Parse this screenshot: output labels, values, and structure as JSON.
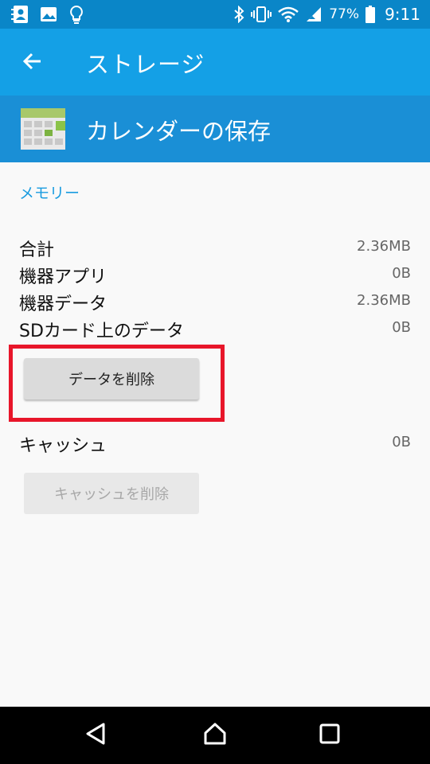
{
  "status_bar": {
    "battery": "77%",
    "time": "9:11",
    "left_icons": [
      "contact-card-icon",
      "image-icon",
      "lightbulb-icon"
    ],
    "right_icons": [
      "bluetooth-icon",
      "vibrate-icon",
      "wifi-icon",
      "signal-icon",
      "battery-icon"
    ]
  },
  "app_bar": {
    "title": "ストレージ",
    "back_icon": "back-arrow-icon"
  },
  "app_header": {
    "name": "カレンダーの保存",
    "icon": "calendar-storage-app-icon"
  },
  "memory": {
    "section_label": "メモリー",
    "rows": [
      {
        "label": "合計",
        "value": "2.36MB"
      },
      {
        "label": "機器アプリ",
        "value": "0B"
      },
      {
        "label": "機器データ",
        "value": "2.36MB"
      },
      {
        "label": "SDカード上のデータ",
        "value": "0B"
      }
    ],
    "clear_data_button": "データを削除"
  },
  "cache": {
    "label": "キャッシュ",
    "value": "0B",
    "clear_cache_button": "キャッシュを削除"
  },
  "nav_bar": {
    "buttons": [
      "back-triangle-icon",
      "home-icon",
      "recents-square-icon"
    ]
  },
  "colors": {
    "status_bar": "#0a86c8",
    "app_bar": "#14a0e6",
    "app_header": "#1a8fd6",
    "accent": "#1a9ce0",
    "highlight": "#e8162a"
  }
}
